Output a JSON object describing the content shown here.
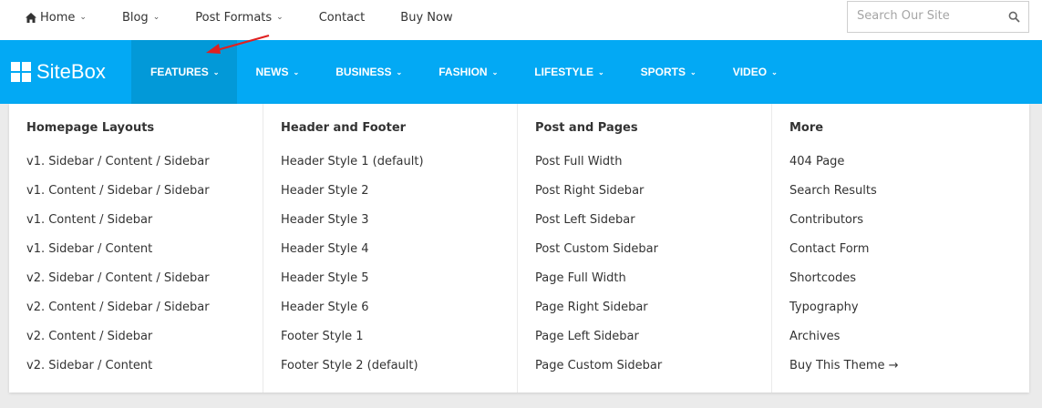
{
  "topbar": {
    "items": [
      {
        "label": "Home",
        "has_dropdown": true,
        "icon": "home-icon"
      },
      {
        "label": "Blog",
        "has_dropdown": true
      },
      {
        "label": "Post Formats",
        "has_dropdown": true
      },
      {
        "label": "Contact",
        "has_dropdown": false
      },
      {
        "label": "Buy Now",
        "has_dropdown": false
      }
    ],
    "search": {
      "placeholder": "Search Our Site",
      "value": "",
      "icon": "search-icon"
    }
  },
  "brand": {
    "name": "SiteBox",
    "color": "#03a9f4",
    "active_color": "#0299d8"
  },
  "mainnav": {
    "items": [
      {
        "label": "FEATURES",
        "active": true
      },
      {
        "label": "NEWS"
      },
      {
        "label": "BUSINESS"
      },
      {
        "label": "FASHION"
      },
      {
        "label": "LIFESTYLE"
      },
      {
        "label": "SPORTS"
      },
      {
        "label": "VIDEO"
      }
    ]
  },
  "dropdown": {
    "columns": [
      {
        "heading": "Homepage Layouts",
        "links": [
          "v1. Sidebar / Content / Sidebar",
          "v1. Content / Sidebar / Sidebar",
          "v1. Content / Sidebar",
          "v1. Sidebar / Content",
          "v2. Sidebar / Content / Sidebar",
          "v2. Content / Sidebar / Sidebar",
          "v2. Content / Sidebar",
          "v2. Sidebar / Content"
        ]
      },
      {
        "heading": "Header and Footer",
        "links": [
          "Header Style 1 (default)",
          "Header Style 2",
          "Header Style 3",
          "Header Style 4",
          "Header Style 5",
          "Header Style 6",
          "Footer Style 1",
          "Footer Style 2 (default)"
        ]
      },
      {
        "heading": "Post and Pages",
        "links": [
          "Post Full Width",
          "Post Right Sidebar",
          "Post Left Sidebar",
          "Post Custom Sidebar",
          "Page Full Width",
          "Page Right Sidebar",
          "Page Left Sidebar",
          "Page Custom Sidebar"
        ]
      },
      {
        "heading": "More",
        "links": [
          "404 Page",
          "Search Results",
          "Contributors",
          "Contact Form",
          "Shortcodes",
          "Typography",
          "Archives",
          "Buy This Theme →"
        ]
      }
    ]
  },
  "annotation": {
    "color": "#e02020"
  }
}
